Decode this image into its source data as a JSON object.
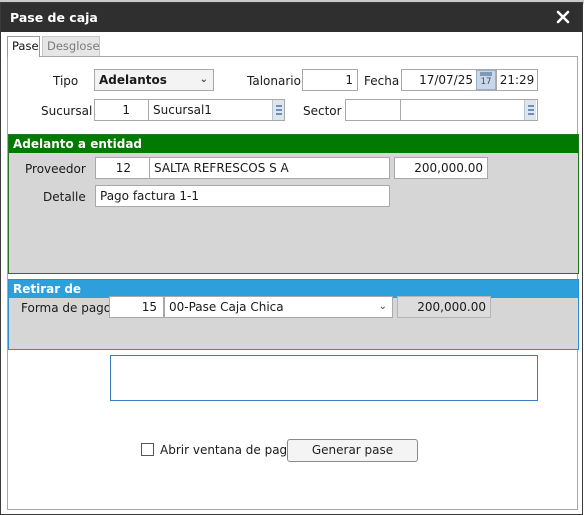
{
  "window": {
    "title": "Pase de caja"
  },
  "tabs": [
    {
      "label": "Pase"
    },
    {
      "label": "Desglose"
    }
  ],
  "header": {
    "tipo_label": "Tipo",
    "tipo_value": "Adelantos",
    "talonario_label": "Talonario",
    "talonario_value": "1",
    "fecha_label": "Fecha",
    "fecha_value": "17/07/25",
    "calendar_day": "17",
    "hora_value": "21:29",
    "sucursal_label": "Sucursal",
    "sucursal_code": "1",
    "sucursal_name": "Sucursal1",
    "sector_label": "Sector",
    "sector_code": "",
    "sector_name": ""
  },
  "adelanto": {
    "title": "Adelanto a entidad",
    "title_color": "#007a00",
    "proveedor_label": "Proveedor",
    "proveedor_code": "12",
    "proveedor_name": "SALTA REFRESCOS S A",
    "amount": "200,000.00",
    "detalle_label": "Detalle",
    "detalle_value": "Pago factura 1-1"
  },
  "retirar": {
    "title": "Retirar de",
    "title_color": "#2da0db",
    "forma_label": "Forma de pago",
    "forma_code": "15",
    "forma_value": "00-Pase Caja Chica",
    "amount": "200,000.00"
  },
  "footer": {
    "checkbox_label": "Abrir ventana de pago",
    "checkbox_checked": false,
    "generate_button": "Generar pase"
  },
  "icons": {
    "close": "close-icon",
    "dropdown": "chevron-down-icon",
    "picker": "list-picker-icon",
    "calendar": "calendar-icon"
  }
}
